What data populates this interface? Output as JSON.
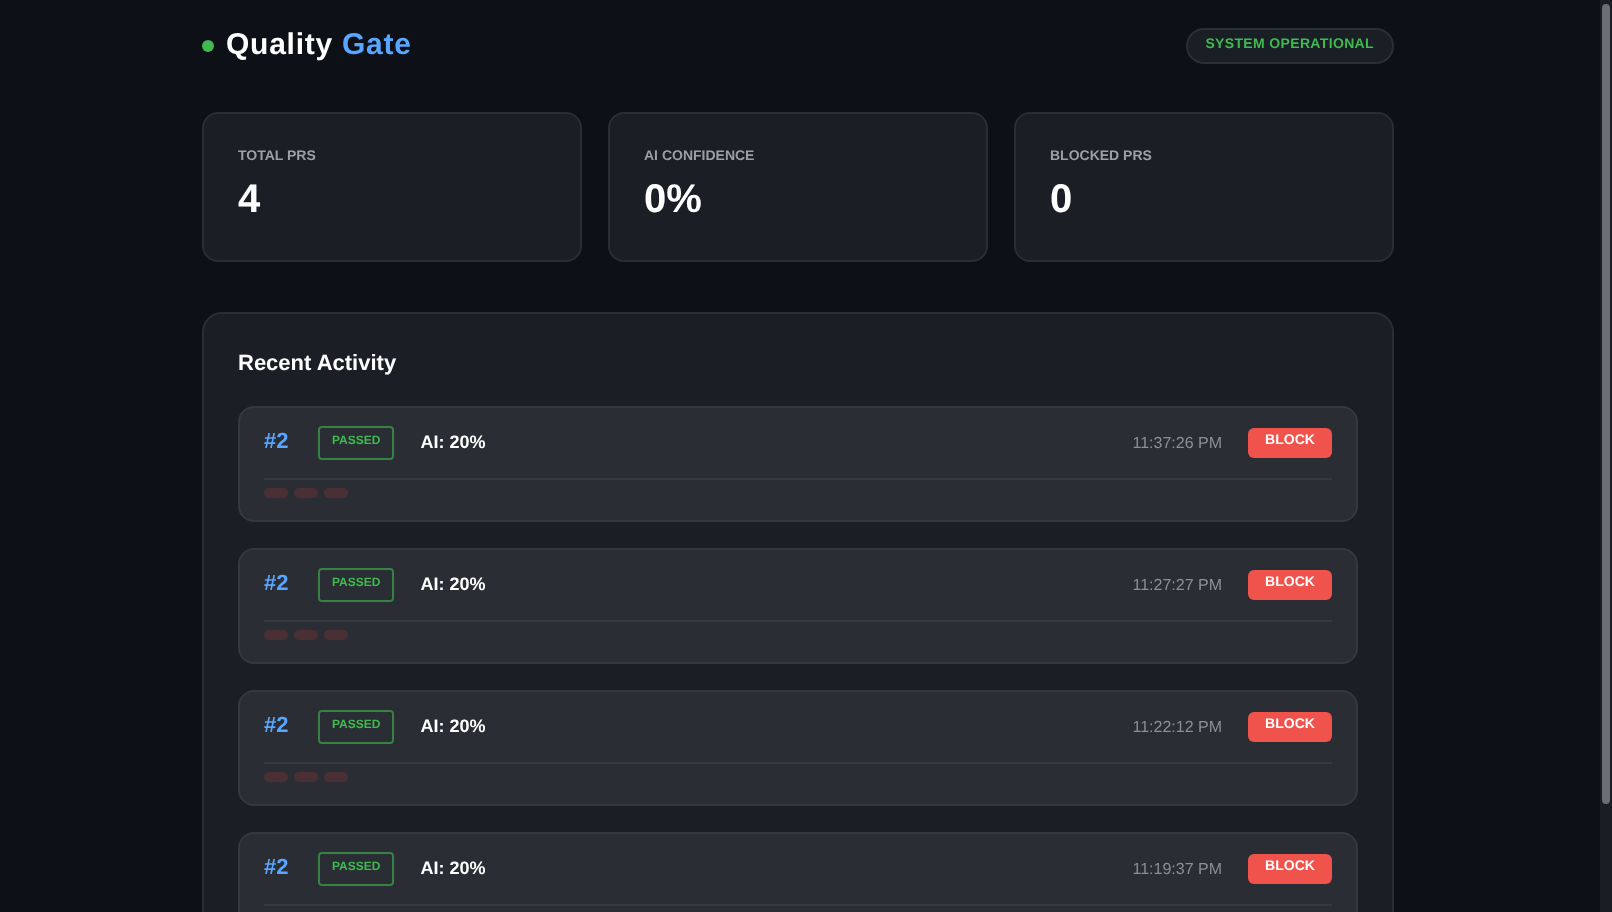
{
  "header": {
    "title_first": "Quality",
    "title_second": "Gate",
    "online": true,
    "status_badge": "SYSTEM OPERATIONAL"
  },
  "stats": [
    {
      "label": "TOTAL PRS",
      "value": "4"
    },
    {
      "label": "AI CONFIDENCE",
      "value": "0%"
    },
    {
      "label": "BLOCKED PRS",
      "value": "0"
    }
  ],
  "activity": {
    "title": "Recent Activity",
    "items": [
      {
        "pr": "#2",
        "status": "PASSED",
        "kind": "passed",
        "ai": "AI: 20%",
        "time": "11:37:26 PM",
        "action": "BLOCK"
      },
      {
        "pr": "#2",
        "status": "PASSED",
        "kind": "passed",
        "ai": "AI: 20%",
        "time": "11:27:27 PM",
        "action": "BLOCK"
      },
      {
        "pr": "#2",
        "status": "PASSED",
        "kind": "passed",
        "ai": "AI: 20%",
        "time": "11:22:12 PM",
        "action": "BLOCK"
      },
      {
        "pr": "#2",
        "status": "PASSED",
        "kind": "passed",
        "ai": "AI: 20%",
        "time": "11:19:37 PM",
        "action": "BLOCK"
      }
    ]
  }
}
